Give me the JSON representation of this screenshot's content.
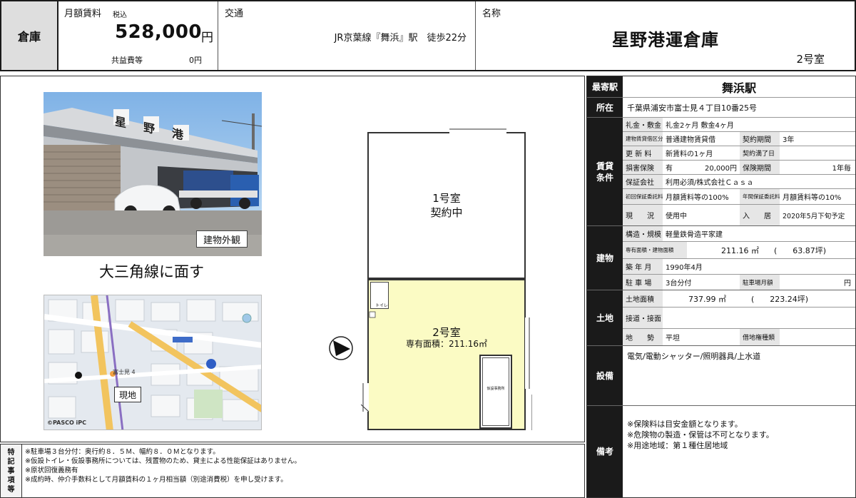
{
  "header": {
    "category": "倉庫",
    "rent_label": "月額賃料",
    "rent_tax": "税込",
    "rent_value": "528,000",
    "rent_unit": "円",
    "common_fee_label": "共益費等",
    "common_fee_value": "0円",
    "access_label": "交通",
    "access_value": "JR京葉線『舞浜』駅　徒歩22分",
    "name_label": "名称",
    "name_value": "星野港運倉庫",
    "room_value": "2号室"
  },
  "photo": {
    "sign": "星野港",
    "caption": "建物外観"
  },
  "tagline": "大三角線に面す",
  "map": {
    "location_label": "現地",
    "area_label": "富士見 4",
    "credit": "©PASCO  iPC"
  },
  "floorplan": {
    "room1_name": "1号室",
    "room1_status": "契約中",
    "room2_name": "2号室",
    "room2_area": "専有面積：211.16㎡",
    "toilet_label": "トイレ",
    "office_label": "仮設事務所"
  },
  "notes": {
    "label": [
      "特",
      "記",
      "事",
      "項",
      "等"
    ],
    "lines": [
      "※駐車場３台分付：奥行約８．５Ｍ、幅約８．０Ｍとなります。",
      "※仮設トイレ・仮設事務所については、残置物のため、貸主による性能保証はありません。",
      "※原状回復義務有",
      "※成約時、仲介手数料として月額賃料の１ヶ月相当額（別途消費税）を申し受けます。"
    ]
  },
  "details": {
    "nearest_station_label": "最寄駅",
    "nearest_station": "舞浜駅",
    "address_label": "所在",
    "address": "千葉県浦安市富士見４丁目10番25号",
    "lease_label": [
      "賃貸",
      "条件"
    ],
    "key_money_label": "礼金・敷金",
    "key_money": "礼金2ヶ月 敷金4ヶ月",
    "lease_type_label": "建物賃貸借区分",
    "lease_type": "普通建物賃貸借",
    "term_label": "契約期間",
    "term": "3年",
    "renewal_fee_label": "更 新 料",
    "renewal_fee": "新賃料の1ヶ月",
    "contract_end_label": "契約満了日",
    "contract_end": "",
    "insurance_label": "損害保険",
    "insurance_flag": "有",
    "insurance_amount": "20,000円",
    "insurance_period_label": "保険期間",
    "insurance_period": "1年毎",
    "guarantor_label": "保証会社",
    "guarantor": "利用必須/株式会社Ｃａｓａ",
    "initial_fee_label": "初回保証委託料",
    "initial_fee": "月額賃料等の100%",
    "annual_fee_label": "年間保証委託料",
    "annual_fee": "月額賃料等の10%",
    "status_label": "現　　況",
    "status": "使用中",
    "movein_label": "入　　居",
    "movein": "2020年5月下旬予定",
    "building_label": "建物",
    "structure_label": "構造・規模",
    "structure": "軽量鉄骨造平家建",
    "area_label": "専有面積・建物面積",
    "area_sqm": "211.16 ㎡",
    "area_tsubo": "(　　63.87坪)",
    "built_label": "築 年 月",
    "built": "1990年4月",
    "parking_label": "駐 車 場",
    "parking": "3台分付",
    "parking_fee_label": "駐車場月額",
    "parking_fee": "円",
    "land_label": "土地",
    "land_area_label": "土地面積",
    "land_area_sqm": "737.99 ㎡",
    "land_area_tsubo": "(　　223.24坪)",
    "road_label": "接道・接面",
    "road": "",
    "terrain_label": "地　　勢",
    "terrain": "平坦",
    "land_right_label": "借地権種類",
    "land_right": "",
    "facilities_label": "設備",
    "facilities": "電気/電動シャッター/照明器具/上水道",
    "remarks_label": "備考",
    "remarks": [
      "※保険料は目安金額となります。",
      "※危険物の製造・保管は不可となります。",
      "※用途地域：第１種住居地域"
    ]
  },
  "colors": {
    "room2_fill": "#fbfbc4",
    "section_fill": "#1a1a1a",
    "label_fill": "#e6e6e6"
  }
}
